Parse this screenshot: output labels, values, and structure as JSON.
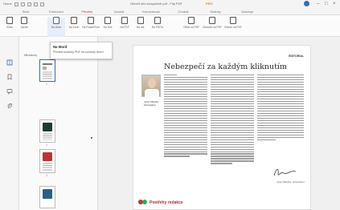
{
  "titlebar": {
    "home_label": "Home",
    "window_title": "Otevřít dílo kompletně pdf - Flip PDF",
    "pro_badge": "PRO"
  },
  "tabs": [
    {
      "label": "Start"
    },
    {
      "label": "Exkluzivní"
    },
    {
      "label": "Převést"
    },
    {
      "label": "Upravit"
    },
    {
      "label": "Komentovat"
    },
    {
      "label": "Chránit"
    },
    {
      "label": "Stránky"
    },
    {
      "label": "Nástroje"
    }
  ],
  "toolbar": {
    "tools": [
      {
        "label": "Ruka"
      },
      {
        "label": "Vybrat"
      },
      {
        "label": "Na Word"
      },
      {
        "label": "Na Excel"
      },
      {
        "label": "Na PowerPoint"
      },
      {
        "label": "Na Text"
      },
      {
        "label": "Na PDF"
      },
      {
        "label": "Na obr."
      },
      {
        "label": "Na PDF/A"
      },
      {
        "label": "Office na PDF"
      },
      {
        "label": "Obrázek na PDF"
      },
      {
        "label": "Skener na PDF"
      }
    ]
  },
  "tooltip": {
    "title": "Na Word",
    "text": "Převést soubory PDF na soubory Word"
  },
  "thumbs": {
    "header": "Miniatury",
    "pages": [
      {
        "num": "1"
      },
      {
        "num": "2"
      },
      {
        "num": "3"
      }
    ]
  },
  "page": {
    "magazine_tag": "EDITORIAL",
    "headline": "Nebezpečí za každým kliknutím",
    "caption_name": "Josef Mikulka",
    "caption_role": "šéfredaktor",
    "signature_name": "Josef Mikulka",
    "signature_role": "šéfredaktor",
    "footer_label": "Postřehy redakce"
  },
  "colors": {
    "accent": "#c0392b",
    "select_blue": "#2d6fb3"
  }
}
